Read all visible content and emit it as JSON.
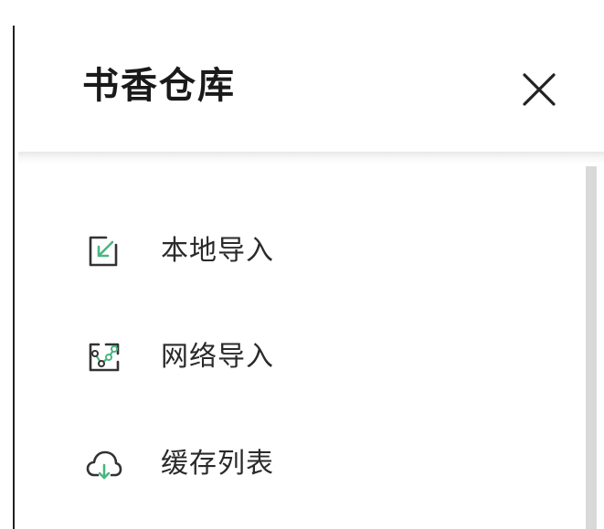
{
  "header": {
    "title": "书香仓库",
    "close_icon": "close-icon"
  },
  "menu": {
    "items": [
      {
        "label": "本地导入",
        "icon": "local-import-icon"
      },
      {
        "label": "网络导入",
        "icon": "network-import-icon"
      },
      {
        "label": "缓存列表",
        "icon": "cloud-download-icon"
      }
    ]
  },
  "colors": {
    "accent": "#4cb582",
    "icon_stroke": "#333333",
    "text": "#2a2a2a",
    "title": "#1a1a1a",
    "scrollbar": "#d9d9d9"
  }
}
